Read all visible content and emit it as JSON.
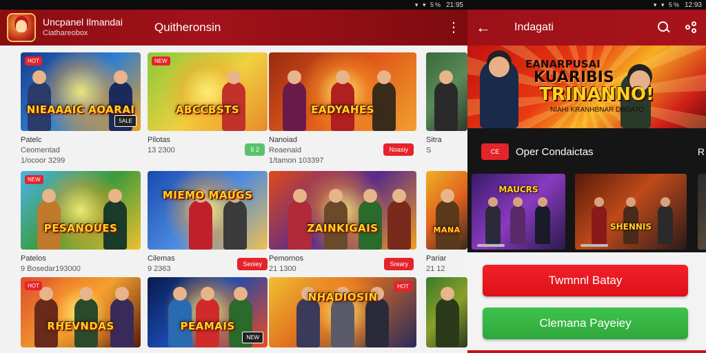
{
  "left": {
    "status": {
      "time": "21:95",
      "icons": "▾ ▾ 5%"
    },
    "appbar": {
      "brand_line1": "Uncpanel Ilmandai",
      "brand_line2": "Ciathareobox",
      "section_title": "Quitheronsin",
      "menu_icon": "kebab-menu-icon"
    },
    "cards": [
      {
        "title": "NIEAAAIC AOARAI",
        "badge": "HOT",
        "corner": "5ALE",
        "line1": "Patelc",
        "line2": "Ceomentad",
        "line3": "1/ocoor 3299",
        "pill": "",
        "pill_color": ""
      },
      {
        "title": "ABCCBSTS",
        "badge": "NEW",
        "corner": "",
        "line1": "Pilotas",
        "line2": "13 2300",
        "line3": "",
        "pill": "5 2",
        "pill_color": "green"
      },
      {
        "title": "EADYAHES",
        "badge": "",
        "corner": "",
        "line1": "Nanoiad",
        "line2": "Reaenaid",
        "line3": "1/tamon 103397",
        "pill": "Noasiy",
        "pill_color": "red"
      },
      {
        "title": "",
        "badge": "",
        "corner": "",
        "line1": "Sitra",
        "line2": "S",
        "line3": "",
        "pill": "",
        "pill_color": ""
      },
      {
        "title": "PESANOUES",
        "badge": "NEW",
        "corner": "",
        "line1": "Patelos",
        "line2": "9 Bosedar193000",
        "line3": "",
        "pill": "",
        "pill_color": ""
      },
      {
        "title": "MIEMO MAUGS",
        "badge": "",
        "corner": "",
        "line1": "Cilemas",
        "line2": "9 2363",
        "line3": "",
        "pill": "Seoiey",
        "pill_color": "red"
      },
      {
        "title": "ZAINKIGAIS",
        "badge": "",
        "corner": "",
        "line1": "Pemornos",
        "line2": "21 1300",
        "line3": "",
        "pill": "Sreary",
        "pill_color": "red"
      },
      {
        "title": "MANA",
        "badge": "",
        "corner": "",
        "line1": "Pariar",
        "line2": "21 12",
        "line3": "",
        "pill": "",
        "pill_color": ""
      },
      {
        "title": "RHEVNDAS",
        "badge": "HOT",
        "corner": "",
        "line1": "",
        "line2": "",
        "line3": "",
        "pill": "",
        "pill_color": ""
      },
      {
        "title": "PEAMAIS",
        "badge": "",
        "corner": "NEW",
        "line1": "",
        "line2": "",
        "line3": "",
        "pill": "",
        "pill_color": ""
      },
      {
        "title": "NHADIOSIN",
        "badge": "",
        "corner": "HOT",
        "line1": "",
        "line2": "",
        "line3": "",
        "pill": "",
        "pill_color": ""
      },
      {
        "title": "",
        "badge": "",
        "corner": "",
        "line1": "",
        "line2": "",
        "line3": "",
        "pill": "",
        "pill_color": ""
      }
    ]
  },
  "right": {
    "status": {
      "time": "12:93",
      "icons": "▾ ▾ 5%"
    },
    "appbar": {
      "title": "Indagati",
      "back_icon": "back-arrow-icon",
      "search_icon": "search-icon",
      "share_icon": "share-icon"
    },
    "banner": {
      "line1": "EANARPUSAI",
      "line2": "KUARIBIS",
      "line3": "TRINANNO!",
      "line4": "NIAHI KRANHBNAR DBOATO"
    },
    "section": {
      "tag": "CE",
      "title": "Oper Condaictas",
      "more": "R"
    },
    "tiles": [
      {
        "title": "MAUCRS"
      },
      {
        "title": "SHENNIS"
      },
      {
        "title": ""
      }
    ],
    "primary_button": "Twmnnl Batay",
    "secondary_button": "Clemana Payeiey"
  }
}
